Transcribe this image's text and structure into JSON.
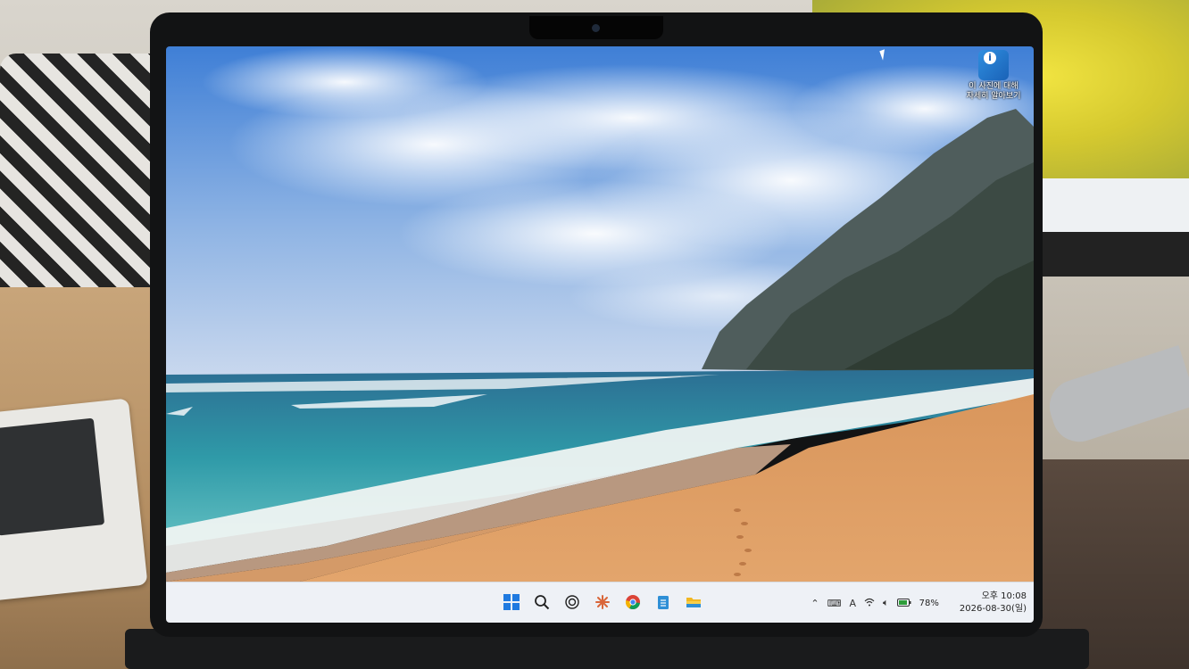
{
  "desktop": {
    "icon_label": "이 사진에 대해 자세히 알아보기"
  },
  "taskbar": {
    "pinned": [
      {
        "name": "start-button",
        "glyph": "windows-logo-icon"
      },
      {
        "name": "search-button",
        "glyph": "search-icon"
      },
      {
        "name": "chatgpt-button",
        "glyph": "chatgpt-icon"
      },
      {
        "name": "claude-button",
        "glyph": "claude-icon"
      },
      {
        "name": "chrome-button",
        "glyph": "chrome-icon"
      },
      {
        "name": "notepad-button",
        "glyph": "notepad-icon"
      },
      {
        "name": "file-explorer-button",
        "glyph": "folder-icon"
      }
    ],
    "tray": {
      "ime_lang": "A",
      "battery": "78%",
      "time": "오후 10:08",
      "date": "2026-08-30(일)"
    }
  },
  "colors": {
    "taskbar_bg": "#eef1f6",
    "start_blue": "#1f7ae0",
    "battery_green": "#2e9d3a"
  }
}
